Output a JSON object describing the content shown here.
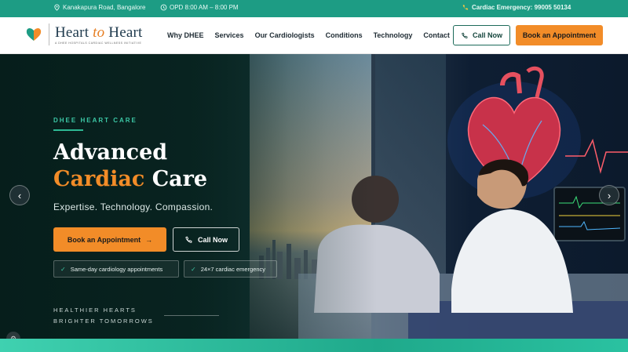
{
  "topbar": {
    "location": "Kanakapura Road, Bangalore",
    "opd": "OPD 8:00 AM – 8:00 PM",
    "emergency": "Cardiac Emergency: 99005 50134",
    "icons": [
      "location-pin-icon",
      "clock-icon",
      "phone-icon"
    ]
  },
  "brand": {
    "name_part1": "Heart",
    "name_part2": "to",
    "name_part3": "Heart",
    "tagline": "A DHEE HOSPITALS CARDIAC WELLNESS INITIATIVE",
    "colors": {
      "teal": "#1d9c84",
      "orange": "#f28c28",
      "navy": "#1f3a4d"
    }
  },
  "nav": {
    "items": [
      "Why DHEE",
      "Services",
      "Our Cardiologists",
      "Conditions",
      "Technology",
      "Contact"
    ],
    "call_label": "Call Now",
    "book_label": "Book an Appointment"
  },
  "hero": {
    "eyebrow": "DHEE HEART CARE",
    "heading_line1": "Advanced",
    "heading_accent": "Cardiac",
    "heading_rest": "Care",
    "tagline": "Expertise. Technology. Compassion.",
    "book_label": "Book an Appointment",
    "call_label": "Call Now",
    "chips": [
      "Same-day cardiology appointments",
      "24×7 cardiac emergency"
    ],
    "footer_line1": "HEALTHIER HEARTS",
    "footer_line2": "BRIGHTER TOMORROWS"
  }
}
